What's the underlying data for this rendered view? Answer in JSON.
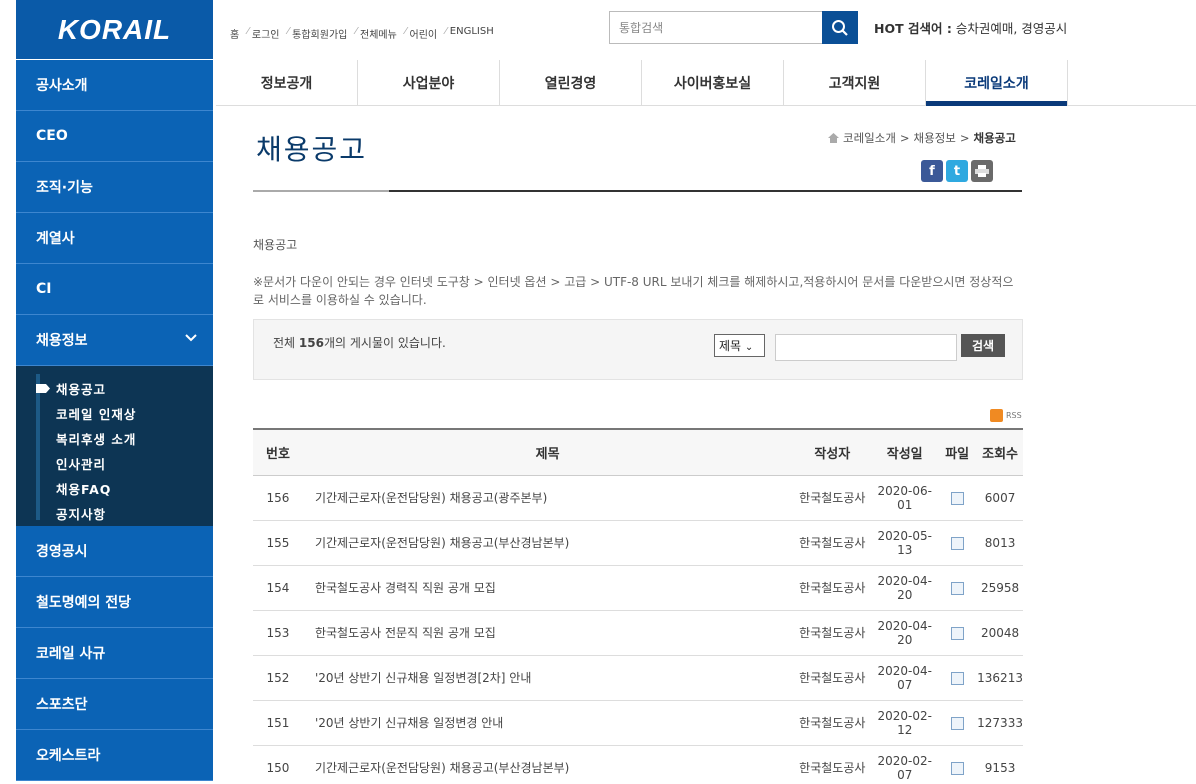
{
  "logo": {
    "text": "KORAIL"
  },
  "util_links": [
    "홈",
    "로그인",
    "통합회원가입",
    "전체메뉴",
    "어린이",
    "ENGLISH"
  ],
  "search": {
    "placeholder": "통합검색"
  },
  "hot": {
    "label": "HOT 검색어 :",
    "terms": "승차권예매, 경영공시"
  },
  "sidebar": {
    "items_top": [
      "공사소개",
      "CEO",
      "조직·기능",
      "계열사",
      "CI",
      "채용정보"
    ],
    "subitems": [
      "채용공고",
      "코레일 인재상",
      "복리후생 소개",
      "인사관리",
      "채용FAQ",
      "공지사항"
    ],
    "items_bottom": [
      "경영공시",
      "철도명예의 전당",
      "코레일 사규",
      "스포츠단",
      "오케스트라"
    ]
  },
  "mainnav": [
    "정보공개",
    "사업분야",
    "열린경영",
    "사이버홍보실",
    "고객지원",
    "코레일소개"
  ],
  "page": {
    "title": "채용공고",
    "breadcrumb": [
      "코레일소개",
      "채용정보",
      "채용공고"
    ],
    "desc1": "채용공고",
    "desc2": "※문서가 다운이 안되는 경우 인터넷 도구창 > 인터넷 옵션 > 고급 > UTF-8 URL 보내기 체크를 해제하시고,적용하시어 문서를 다운받으시면 정상적으로 서비스를 이용하실 수 있습니다."
  },
  "board": {
    "total_prefix": "전체 ",
    "total_count": "156",
    "total_suffix": "개의 게시물이 있습니다.",
    "select_value": "제목",
    "search_btn": "검색",
    "rss": "RSS",
    "headers": [
      "번호",
      "제목",
      "작성자",
      "작성일",
      "파일",
      "조회수"
    ],
    "rows": [
      {
        "no": "156",
        "title": "기간제근로자(운전담당원) 채용공고(광주본부)",
        "author": "한국철도공사",
        "date": "2020-06-01",
        "views": "6007"
      },
      {
        "no": "155",
        "title": "기간제근로자(운전담당원) 채용공고(부산경남본부)",
        "author": "한국철도공사",
        "date": "2020-05-13",
        "views": "8013"
      },
      {
        "no": "154",
        "title": "한국철도공사 경력직 직원 공개 모집",
        "author": "한국철도공사",
        "date": "2020-04-20",
        "views": "25958"
      },
      {
        "no": "153",
        "title": "한국철도공사 전문직 직원 공개 모집",
        "author": "한국철도공사",
        "date": "2020-04-20",
        "views": "20048"
      },
      {
        "no": "152",
        "title": "'20년 상반기 신규채용 일정변경[2차] 안내",
        "author": "한국철도공사",
        "date": "2020-04-07",
        "views": "136213"
      },
      {
        "no": "151",
        "title": "'20년 상반기 신규채용 일정변경 안내",
        "author": "한국철도공사",
        "date": "2020-02-12",
        "views": "127333"
      },
      {
        "no": "150",
        "title": "기간제근로자(운전담당원) 채용공고(부산경남본부)",
        "author": "한국철도공사",
        "date": "2020-02-07",
        "views": "9153"
      }
    ]
  }
}
